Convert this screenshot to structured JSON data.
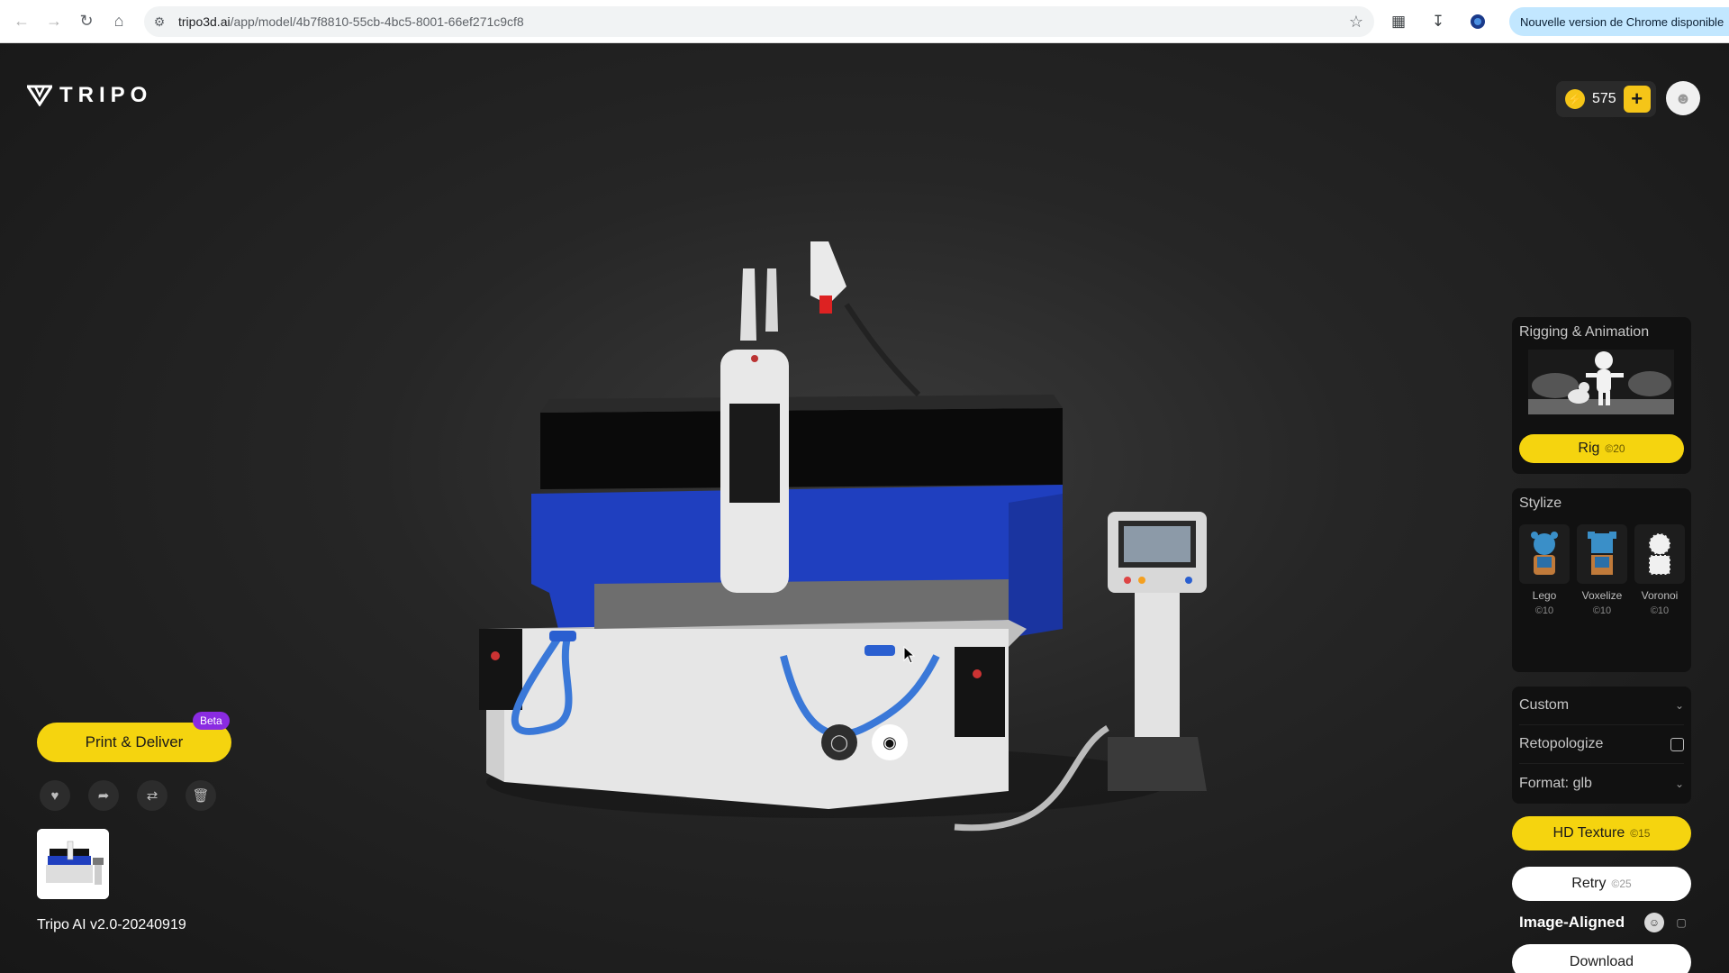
{
  "browser": {
    "url_domain": "tripo3d.ai",
    "url_path": "/app/model/4b7f8810-55cb-4bc5-8001-66ef271c9cf8",
    "update_label": "Nouvelle version de Chrome disponible"
  },
  "app": {
    "logo_text": "TRIPO",
    "credits": "575",
    "model_version": "Tripo AI v2.0-20240919"
  },
  "left_panel": {
    "print_label": "Print & Deliver",
    "beta_label": "Beta"
  },
  "right_panel": {
    "rigging": {
      "title": "Rigging & Animation",
      "rig_label": "Rig",
      "rig_cost": "©20"
    },
    "stylize": {
      "title": "Stylize",
      "items": [
        {
          "name": "Lego",
          "cost": "©10"
        },
        {
          "name": "Voxelize",
          "cost": "©10"
        },
        {
          "name": "Voronoi",
          "cost": "©10"
        }
      ]
    },
    "options": {
      "custom_label": "Custom",
      "retopologize_label": "Retopologize",
      "format_label": "Format: glb"
    },
    "hd_texture_label": "HD Texture",
    "hd_texture_cost": "©15",
    "retry_label": "Retry",
    "retry_cost": "©25",
    "image_aligned_label": "Image-Aligned",
    "download_label": "Download"
  },
  "colors": {
    "accent_yellow": "#f5d40f",
    "beta_purple": "#8a2be2",
    "machine_blue": "#1f3fbf"
  }
}
